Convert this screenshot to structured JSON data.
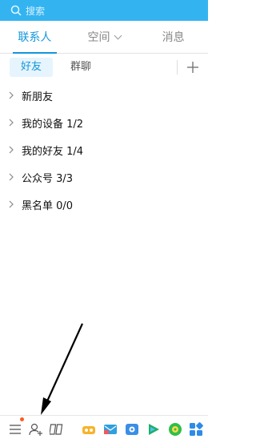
{
  "search": {
    "placeholder": "搜索"
  },
  "tabs": [
    {
      "label": "联系人",
      "active": true
    },
    {
      "label": "空间",
      "active": false,
      "has_dropdown": true
    },
    {
      "label": "消息",
      "active": false
    }
  ],
  "subtabs": [
    {
      "label": "好友",
      "active": true
    },
    {
      "label": "群聊",
      "active": false
    }
  ],
  "groups": [
    {
      "label": "新朋友"
    },
    {
      "label": "我的设备 1/2"
    },
    {
      "label": "我的好友 1/4"
    },
    {
      "label": "公众号 3/3"
    },
    {
      "label": "黑名单 0/0"
    }
  ],
  "bottom_toolbar": {
    "icons": [
      "menu-icon",
      "add-contact-icon",
      "app-manager-icon",
      "game-icon",
      "mail-icon",
      "weiyun-icon",
      "video-icon",
      "music-icon",
      "apps-grid-icon"
    ],
    "notification_dot": true
  },
  "colors": {
    "header_blue": "#33b4f1",
    "active_blue": "#1296db",
    "dot_orange": "#ff5a1f"
  }
}
